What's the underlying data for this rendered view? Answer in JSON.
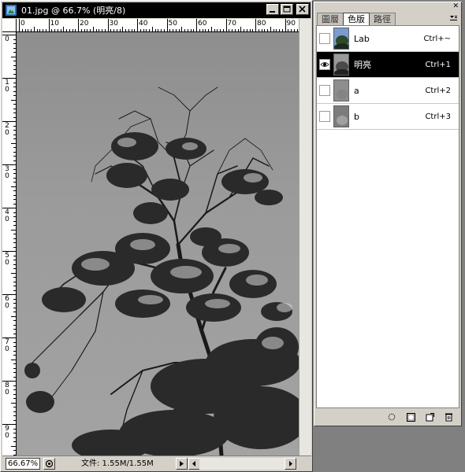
{
  "window": {
    "title": "01.jpg @ 66.7% (明亮/8)",
    "icons": [
      "photoshop-app-icon",
      "minimize-icon",
      "restore-icon",
      "close-icon"
    ]
  },
  "rulers": {
    "top_labels": [
      "0",
      "10",
      "20",
      "30",
      "40",
      "50",
      "60",
      "70",
      "80",
      "90"
    ],
    "left_labels": [
      "0",
      "1\n0",
      "2\n0",
      "3\n0",
      "4\n0",
      "5\n0",
      "6\n0",
      "7\n0",
      "8\n0",
      "9\n0"
    ]
  },
  "status": {
    "zoom": "66.67%",
    "doc_info": "文件: 1.55M/1.55M"
  },
  "panel": {
    "tabs": [
      {
        "label": "圖層",
        "active": false
      },
      {
        "label": "色版",
        "active": true
      },
      {
        "label": "路徑",
        "active": false
      }
    ],
    "channels": [
      {
        "name": "Lab",
        "shortcut": "Ctrl+~",
        "visible": false,
        "selected": false,
        "thumb": "color"
      },
      {
        "name": "明亮",
        "shortcut": "Ctrl+1",
        "visible": true,
        "selected": true,
        "thumb": "gray"
      },
      {
        "name": "a",
        "shortcut": "Ctrl+2",
        "visible": false,
        "selected": false,
        "thumb": "flat"
      },
      {
        "name": "b",
        "shortcut": "Ctrl+3",
        "visible": false,
        "selected": false,
        "thumb": "flat"
      }
    ],
    "footer_icons": [
      "load-channel-as-selection-icon",
      "save-selection-as-channel-icon",
      "new-channel-icon",
      "trash-icon"
    ]
  },
  "colors": {
    "selected_row": "#000000",
    "panel_bg": "#d4d0c8",
    "workspace": "#808080"
  }
}
